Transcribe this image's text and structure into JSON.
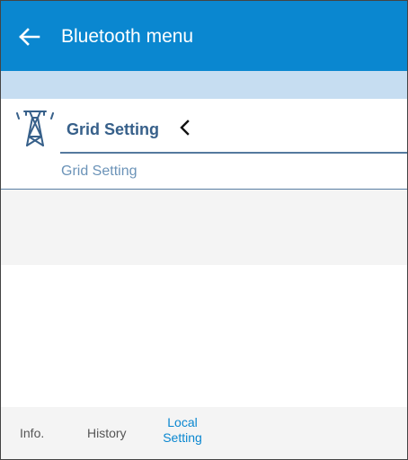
{
  "header": {
    "back_icon": "arrow-left-icon",
    "title": "Bluetooth menu"
  },
  "section": {
    "icon": "power-tower-icon",
    "title": "Grid Setting",
    "toggle_icon": "chevron-left-icon"
  },
  "submenu": {
    "items": [
      {
        "label": "Grid Setting"
      }
    ]
  },
  "bottom_nav": {
    "tabs": [
      {
        "label": "Info."
      },
      {
        "label": "History"
      },
      {
        "label_line1": "Local",
        "label_line2": "Setting",
        "active": true
      }
    ]
  },
  "colors": {
    "primary": "#0a87d0",
    "band": "#c6ddf1",
    "section_title": "#37608a",
    "sub_item": "#6b93b8",
    "nav_background": "#f4f4f4"
  }
}
